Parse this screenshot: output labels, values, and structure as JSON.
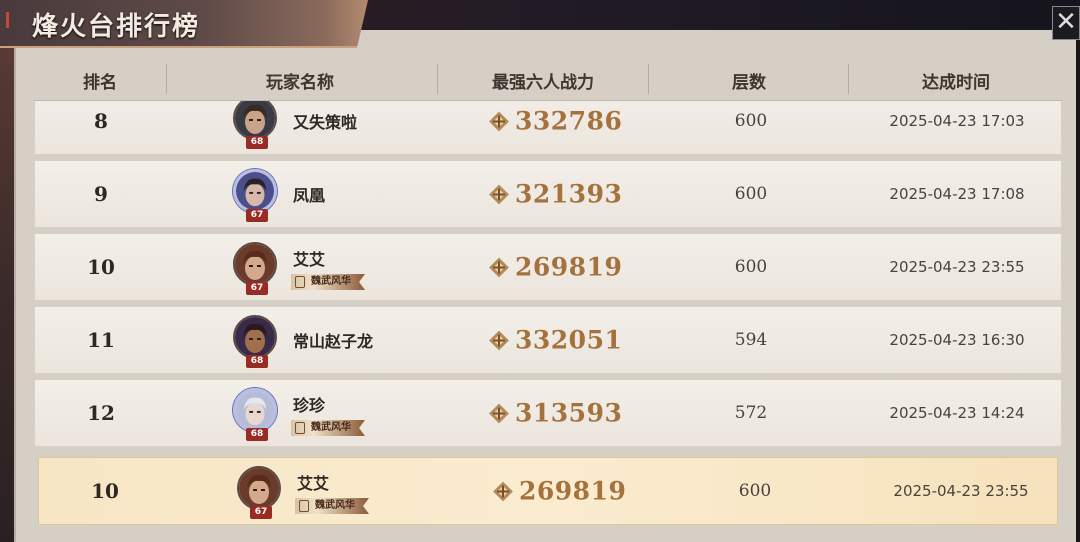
{
  "title": "烽火台排行榜",
  "close_label": "✕",
  "columns": {
    "rank": "排名",
    "player": "玩家名称",
    "power": "最强六人战力",
    "floors": "层数",
    "time": "达成时间"
  },
  "rows": [
    {
      "rank": "8",
      "name": "又失策啦",
      "level": "68",
      "power": "332786",
      "floors": "600",
      "time": "2025-04-23 17:03",
      "avatar": "armored-man",
      "badge": ""
    },
    {
      "rank": "9",
      "name": "凤凰",
      "level": "67",
      "power": "321393",
      "floors": "600",
      "time": "2025-04-23 17:08",
      "avatar": "glasses-man",
      "badge": ""
    },
    {
      "rank": "10",
      "name": "艾艾",
      "level": "67",
      "power": "269819",
      "floors": "600",
      "time": "2025-04-23 23:55",
      "avatar": "brown-hair-man",
      "badge": "魏武风华"
    },
    {
      "rank": "11",
      "name": "常山赵子龙",
      "level": "68",
      "power": "332051",
      "floors": "594",
      "time": "2025-04-23 16:30",
      "avatar": "dark-skin-man",
      "badge": ""
    },
    {
      "rank": "12",
      "name": "珍珍",
      "level": "68",
      "power": "313593",
      "floors": "572",
      "time": "2025-04-23 14:24",
      "avatar": "white-hair-man",
      "badge": "魏武风华"
    }
  ],
  "self_row": {
    "rank": "10",
    "name": "艾艾",
    "level": "67",
    "power": "269819",
    "floors": "600",
    "time": "2025-04-23 23:55",
    "avatar": "brown-hair-man",
    "badge": "魏武风华"
  },
  "colors": {
    "accent": "#a5723e",
    "highlight": "#fbecd0",
    "level_badge": "#9a2a24"
  }
}
